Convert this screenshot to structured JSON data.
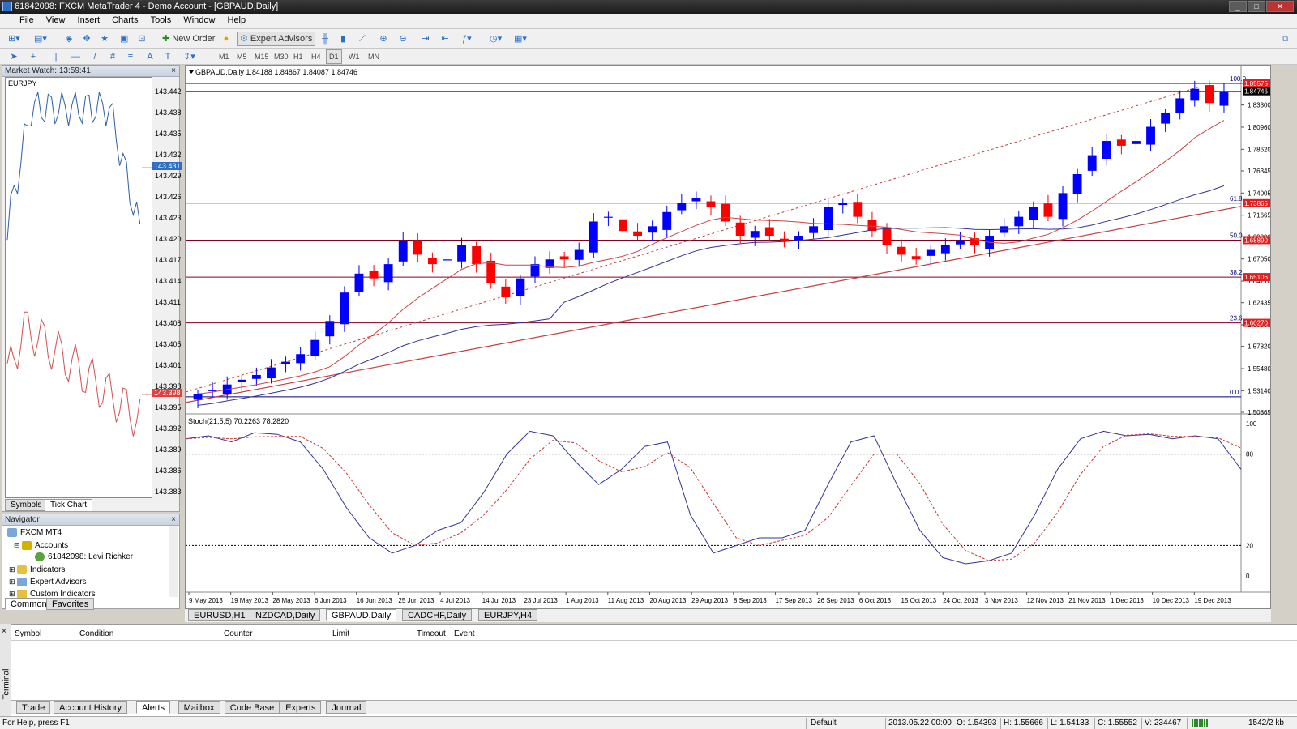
{
  "window": {
    "title": "61842098: FXCM MetaTrader 4 - Demo Account - [GBPAUD,Daily]"
  },
  "menu": [
    "File",
    "View",
    "Insert",
    "Charts",
    "Tools",
    "Window",
    "Help"
  ],
  "toolbar": {
    "new_order": "New Order",
    "expert_advisors": "Expert Advisors"
  },
  "timeframes": [
    "M1",
    "M5",
    "M15",
    "M30",
    "H1",
    "H4",
    "D1",
    "W1",
    "MN"
  ],
  "market_watch": {
    "title": "Market Watch: 13:59:41",
    "symbol": "EURJPY",
    "price_ticks": [
      "143.442",
      "143.438",
      "143.435",
      "143.432",
      "143.429",
      "143.426",
      "143.423",
      "143.420",
      "143.417",
      "143.414",
      "143.411",
      "143.408",
      "143.405",
      "143.401",
      "143.398",
      "143.395",
      "143.392",
      "143.389",
      "143.386",
      "143.383"
    ],
    "ask": "143.431",
    "bid": "143.398",
    "tabs": [
      "Symbols",
      "Tick Chart"
    ]
  },
  "navigator": {
    "title": "Navigator",
    "items": [
      "FXCM MT4",
      "Accounts",
      "61842098: Levi Richker",
      "Indicators",
      "Expert Advisors",
      "Custom Indicators"
    ],
    "tabs": [
      "Common",
      "Favorites"
    ]
  },
  "chart": {
    "header": "GBPAUD,Daily  1.84188 1.84867 1.84087 1.84746",
    "stoch_header": "Stoch(21,5,5) 70.2263 78.2820",
    "price_ticks": [
      "1.85575",
      "1.83300",
      "1.80960",
      "1.78620",
      "1.76345",
      "1.74005",
      "1.71665",
      "1.69390",
      "1.67050",
      "1.64710",
      "1.62435",
      "1.60095",
      "1.57820",
      "1.55480",
      "1.53140",
      "1.50865"
    ],
    "stoch_ticks": [
      "100",
      "80",
      "20",
      "0"
    ],
    "date_ticks": [
      "9 May 2013",
      "19 May 2013",
      "28 May 2013",
      "6 Jun 2013",
      "16 Jun 2013",
      "25 Jun 2013",
      "4 Jul 2013",
      "14 Jul 2013",
      "23 Jul 2013",
      "1 Aug 2013",
      "11 Aug 2013",
      "20 Aug 2013",
      "29 Aug 2013",
      "8 Sep 2013",
      "17 Sep 2013",
      "26 Sep 2013",
      "6 Oct 2013",
      "15 Oct 2013",
      "24 Oct 2013",
      "3 Nov 2013",
      "12 Nov 2013",
      "21 Nov 2013",
      "1 Dec 2013",
      "10 Dec 2013",
      "19 Dec 2013"
    ],
    "fib_levels": [
      {
        "label": "100.0",
        "price": "1.85575"
      },
      {
        "label": "61.8",
        "price": "1.73865"
      },
      {
        "label": "50.0",
        "price": "1.68890"
      },
      {
        "label": "38.2",
        "price": "1.65106"
      },
      {
        "label": "23.6",
        "price": "1.60270"
      },
      {
        "label": "0.0",
        "price": ""
      }
    ],
    "current_price": "1.84746",
    "colors": {
      "bull": "#0000ff",
      "bear": "#ff0000",
      "fib": "#800080",
      "sma_fast": "#cc4444",
      "sma_slow": "#333399",
      "trend": "#c04040"
    }
  },
  "chart_data": {
    "type": "candlestick",
    "symbol": "GBPAUD",
    "timeframe": "Daily",
    "ohlc_last": {
      "open": 1.84188,
      "high": 1.84867,
      "low": 1.84087,
      "close": 1.84746
    },
    "x_range": [
      "2013-05-09",
      "2013-12-23"
    ],
    "ylim": [
      1.50865,
      1.85575
    ],
    "closes_approx": [
      1.528,
      1.532,
      1.538,
      1.543,
      1.548,
      1.556,
      1.562,
      1.57,
      1.585,
      1.605,
      1.635,
      1.655,
      1.65,
      1.665,
      1.69,
      1.675,
      1.665,
      1.67,
      1.685,
      1.665,
      1.645,
      1.63,
      1.65,
      1.665,
      1.67,
      1.67,
      1.68,
      1.71,
      1.715,
      1.7,
      1.695,
      1.705,
      1.72,
      1.73,
      1.735,
      1.725,
      1.71,
      1.695,
      1.7,
      1.695,
      1.69,
      1.695,
      1.705,
      1.725,
      1.73,
      1.715,
      1.7,
      1.685,
      1.675,
      1.67,
      1.68,
      1.685,
      1.69,
      1.685,
      1.695,
      1.705,
      1.715,
      1.725,
      1.715,
      1.74,
      1.76,
      1.78,
      1.795,
      1.79,
      1.795,
      1.81,
      1.825,
      1.84,
      1.85,
      1.835,
      1.8475
    ],
    "indicator": {
      "name": "Stoch(21,5,5)",
      "main": 70.2263,
      "signal": 78.282,
      "levels": [
        20,
        80
      ]
    }
  },
  "chart_tabs": [
    "EURUSD,H1",
    "NZDCAD,Daily",
    "GBPAUD,Daily",
    "CADCHF,Daily",
    "EURJPY,H4"
  ],
  "terminal": {
    "columns": [
      "Symbol",
      "Condition",
      "Counter",
      "Limit",
      "Timeout",
      "Event"
    ],
    "tabs": [
      "Trade",
      "Account History",
      "Alerts",
      "Mailbox",
      "Code Base",
      "Experts",
      "Journal"
    ],
    "side_label": "Terminal"
  },
  "status": {
    "help": "For Help, press F1",
    "profile": "Default",
    "datetime": "2013.05.22 00:00",
    "open": "O: 1.54393",
    "high": "H: 1.55666",
    "low": "L: 1.54133",
    "close": "C: 1.55552",
    "volume": "V: 234467",
    "traffic": "1542/2 kb"
  }
}
